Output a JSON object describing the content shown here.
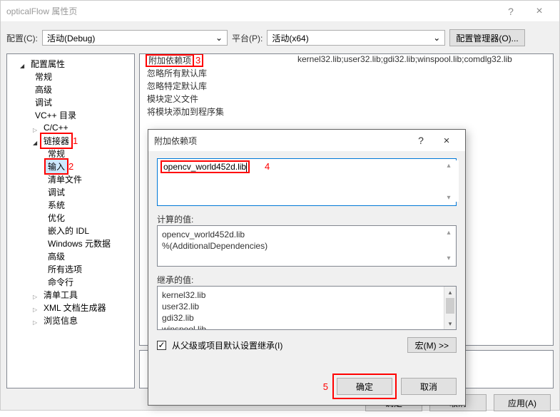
{
  "window": {
    "title": "opticalFlow 属性页",
    "help_glyph": "?",
    "close_glyph": "×"
  },
  "config_row": {
    "config_label": "配置(C):",
    "config_value": "活动(Debug)",
    "platform_label": "平台(P):",
    "platform_value": "活动(x64)",
    "manager_btn": "配置管理器(O)..."
  },
  "tree": {
    "root": "配置属性",
    "items_l2": [
      "常规",
      "高级",
      "调试",
      "VC++ 目录"
    ],
    "cpp": "C/C++",
    "linker": "链接器",
    "linker_children": [
      "常规",
      "输入",
      "清单文件",
      "调试",
      "系统",
      "优化",
      "嵌入的 IDL",
      "Windows 元数据",
      "高级",
      "所有选项",
      "命令行"
    ],
    "after": [
      "清单工具",
      "XML 文档生成器",
      "浏览信息"
    ]
  },
  "annotations": {
    "a1": "1",
    "a2": "2",
    "a3": "3",
    "a4": "4",
    "a5": "5"
  },
  "props": {
    "r1_key": "附加依赖项",
    "r1_val": "kernel32.lib;user32.lib;gdi32.lib;winspool.lib;comdlg32.lib",
    "r2_key": "忽略所有默认库",
    "r3_key": "忽略特定默认库",
    "r4_key": "模块定义文件",
    "r5_key": "将模块添加到程序集"
  },
  "dialog": {
    "title": "附加依赖项",
    "input_value": "opencv_world452d.lib",
    "computed_label": "计算的值:",
    "computed_lines": [
      "opencv_world452d.lib",
      "%(AdditionalDependencies)"
    ],
    "inherited_label": "继承的值:",
    "inherited_lines": [
      "kernel32.lib",
      "user32.lib",
      "gdi32.lib",
      "winspool.lib"
    ],
    "inherit_checkbox_label": "从父级或项目默认设置继承(I)",
    "macro_btn": "宏(M) >>",
    "ok_btn": "确定",
    "cancel_btn": "取消"
  },
  "main_buttons": {
    "ok": "确定",
    "cancel": "取消",
    "apply": "应用(A)"
  },
  "glyphs": {
    "arrow_down": "⌄",
    "arrow_up": "⌃",
    "check": "✓",
    "tri_up": "▴",
    "tri_down": "▾"
  }
}
